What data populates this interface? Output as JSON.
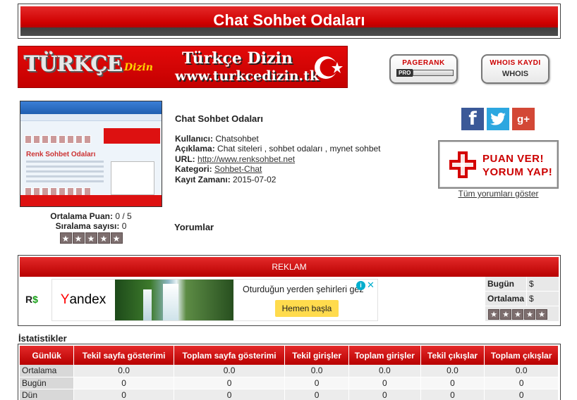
{
  "header": {
    "title": "Chat Sohbet Odaları"
  },
  "banner": {
    "logo": "TÜRKÇE",
    "logo_sub": "Dizin",
    "title": "Türkçe Dizin",
    "url": "www.turkcedizin.tk"
  },
  "badges": {
    "pagerank_top": "PAGERANK",
    "pagerank_pro": "PRO",
    "whois_top": "WHOIS KAYDI",
    "whois_bottom": "WHOIS"
  },
  "site": {
    "thumb_title": "Renk Sohbet Odaları",
    "title": "Chat Sohbet Odaları",
    "user_label": "Kullanıcı:",
    "user": "Chatsohbet",
    "desc_label": "Açıklama:",
    "desc": "Chat siteleri , sohbet odaları , mynet sohbet",
    "url_label": "URL:",
    "url": "http://www.renksohbet.net",
    "category_label": "Kategori:",
    "category": "Sohbet-Chat",
    "date_label": "Kayıt Zamanı:",
    "date": "2015-07-02"
  },
  "rating": {
    "avg_label": "Ortalama Puan:",
    "avg": "0 / 5",
    "count_label": "Sıralama sayısı:",
    "count": "0",
    "stars": [
      "★",
      "★",
      "★",
      "★",
      "★"
    ]
  },
  "comments": {
    "title": "Yorumlar",
    "show_all": "Tüm yorumları göster"
  },
  "social": {
    "facebook": "f",
    "twitter": "t",
    "googleplus": "g+"
  },
  "puan": {
    "line1": "PUAN VER!",
    "line2": "YORUM YAP!"
  },
  "reklam": {
    "title": "REKLAM",
    "currency_prefix": "R",
    "currency_symbol": "$",
    "ad": {
      "brand_first": "Y",
      "brand_rest": "andex",
      "text": "Oturduğun yerden şehirleri gez",
      "button": "Hemen başla",
      "info": "i",
      "close": "✕"
    },
    "stats": [
      {
        "label": "Bugün",
        "value": "$"
      },
      {
        "label": "Ortalama",
        "value": "$"
      }
    ]
  },
  "stats": {
    "title": "İstatistikler",
    "columns": [
      "Günlük",
      "Tekil sayfa gösterimi",
      "Toplam sayfa gösterimi",
      "Tekil girişler",
      "Toplam girişler",
      "Tekil çıkışlar",
      "Toplam çıkışlar"
    ],
    "rows": [
      [
        "Ortalama",
        "0.0",
        "0.0",
        "0.0",
        "0.0",
        "0.0",
        "0.0"
      ],
      [
        "Bugün",
        "0",
        "0",
        "0",
        "0",
        "0",
        "0"
      ],
      [
        "Dün",
        "0",
        "0",
        "0",
        "0",
        "0",
        "0"
      ]
    ]
  },
  "colors": {
    "accent": "#d00000",
    "dark": "#444444"
  }
}
